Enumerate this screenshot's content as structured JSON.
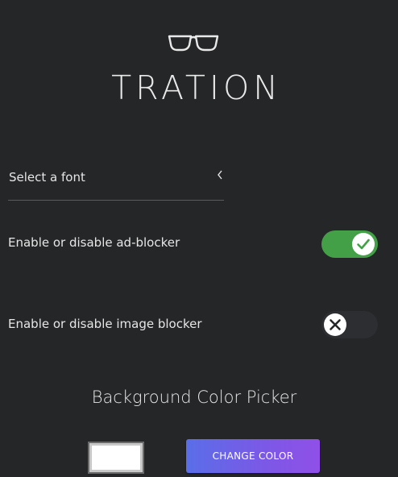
{
  "brand": {
    "name": "TRATION",
    "logo_icon": "glasses-icon"
  },
  "font_select": {
    "label": "Select a font",
    "icon": "chevron-left-icon"
  },
  "settings": [
    {
      "label": "Enable or disable ad-blocker",
      "enabled": true,
      "icon": "check-icon",
      "accent": "#43a047"
    },
    {
      "label": "Enable or disable image blocker",
      "enabled": false,
      "icon": "close-icon"
    }
  ],
  "color_picker": {
    "title": "Background Color Picker",
    "current_color": "#ffffff",
    "button_label": "CHANGE COLOR",
    "button_gradient": [
      "#5a6ee8",
      "#9050e8"
    ]
  }
}
